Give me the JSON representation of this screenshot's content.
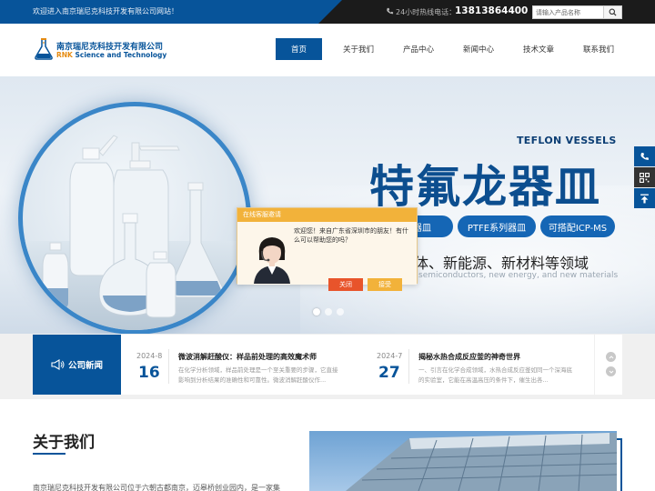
{
  "topbar": {
    "welcome": "欢迎进入南京瑞尼克科技开发有限公司网站！",
    "hotline_label": "24小时热线电话：",
    "hotline_number": "13813864400",
    "search_placeholder": "请输入产品名称"
  },
  "logo": {
    "cn": "南京瑞尼克科技开发有限公司",
    "en_prefix": "RNK",
    "en_suffix": " Science and Technology"
  },
  "nav": {
    "items": [
      {
        "label": "首页",
        "active": true
      },
      {
        "label": "关于我们"
      },
      {
        "label": "产品中心"
      },
      {
        "label": "新闻中心"
      },
      {
        "label": "技术文章"
      },
      {
        "label": "联系我们"
      }
    ]
  },
  "banner": {
    "title_en": "TEFLON VESSELS",
    "title_cn": "特氟龙器皿",
    "pills": [
      "器皿",
      "PTFE系列器皿",
      "可搭配ICP-MS"
    ],
    "fields_cn": "体、新能源、新材料等领域",
    "fields_en": "semiconductors, new energy, and new materials",
    "slides": 3,
    "active_slide": 0
  },
  "chat": {
    "header": "在线客服邀请",
    "message": "欢迎您！来自广东省深圳市的朋友！有什么可以帮助您的吗？",
    "decline": "关闭",
    "accept": "接受"
  },
  "news": {
    "heading": "公司新闻",
    "items": [
      {
        "ym": "2024-8",
        "day": "16",
        "title": "微波消解赶酸仪：样品前处理的高效魔术师",
        "desc": "在化学分析领域，样品前处理是一个至关重要的步骤，它直接影响到分析结果的准确性和可靠性。微波消解赶酸仪作..."
      },
      {
        "ym": "2024-7",
        "day": "27",
        "title": "揭秘水热合成反应釜的神奇世界",
        "desc": "一、引言在化学合成领域，水热合成反应釜如同一个深海底的实验室，它能在高温高压的条件下，催生出各..."
      }
    ]
  },
  "about": {
    "title": "关于我们",
    "text": "南京瑞尼克科技开发有限公司位于六朝古都南京，迈皋桥创业园内，是一家集"
  },
  "colors": {
    "primary": "#07549a",
    "topbar": "#1b1b1b",
    "accent": "#e58b12",
    "chat": "#f2b23a"
  }
}
